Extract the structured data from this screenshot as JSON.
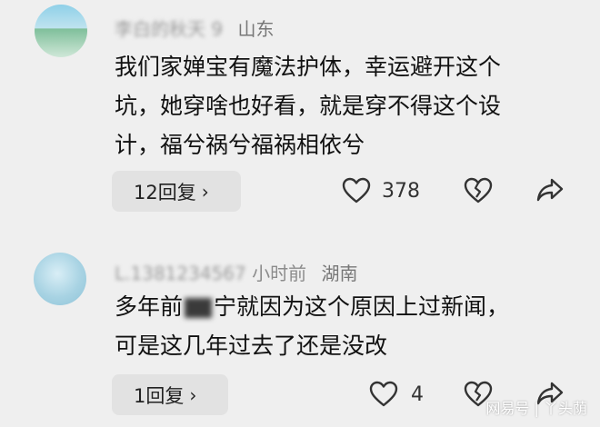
{
  "comments": [
    {
      "username": "李白的秋天",
      "time_fragment": "9",
      "location": "山东",
      "lines": [
        "我们家婵宝有魔法护体，幸运避开这个",
        "坑，她穿啥也好看，就是穿不得这个设",
        "计，福兮祸兮福祸相依兮"
      ],
      "reply_label": "12回复",
      "likes": "378"
    },
    {
      "username": "L.1381234567",
      "time": "小时前",
      "location": "湖南",
      "line1_pre": "多年前",
      "line1_post": "宁就因为这个原因上过新闻，",
      "line2": "可是这几年过去了还是没改",
      "reply_label": "1回复",
      "likes": "4"
    }
  ],
  "icons": {
    "heart": "heart-icon",
    "broken_heart": "broken-heart-icon",
    "share": "share-icon",
    "chevron": "chevron-right-icon"
  },
  "watermark": "网易号 | 丫头荫"
}
